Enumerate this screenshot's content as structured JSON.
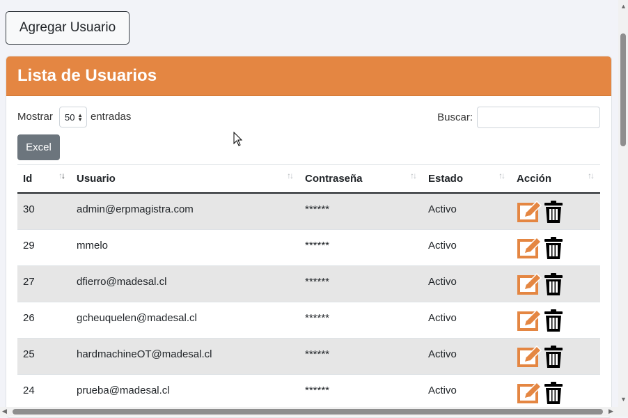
{
  "toolbar": {
    "add_label": "Agregar Usuario"
  },
  "card": {
    "title": "Lista de Usuarios"
  },
  "controls": {
    "show_label": "Mostrar",
    "page_size": "50",
    "entries_label": "entradas",
    "search_label": "Buscar:",
    "search_value": "",
    "excel_label": "Excel"
  },
  "table": {
    "columns": [
      "Id",
      "Usuario",
      "Contraseña",
      "Estado",
      "Acción"
    ],
    "rows": [
      {
        "id": "30",
        "user": "admin@erpmagistra.com",
        "password": "******",
        "status": "Activo"
      },
      {
        "id": "29",
        "user": "mmelo",
        "password": "******",
        "status": "Activo"
      },
      {
        "id": "27",
        "user": "dfierro@madesal.cl",
        "password": "******",
        "status": "Activo"
      },
      {
        "id": "26",
        "user": "gcheuquelen@madesal.cl",
        "password": "******",
        "status": "Activo"
      },
      {
        "id": "25",
        "user": "hardmachineOT@madesal.cl",
        "password": "******",
        "status": "Activo"
      },
      {
        "id": "24",
        "user": "prueba@madesal.cl",
        "password": "******",
        "status": "Activo"
      }
    ]
  },
  "icons": {
    "edit": "edit-icon",
    "delete": "trash-icon",
    "sort": "sort-icon"
  },
  "colors": {
    "header": "#e48642",
    "excel": "#6c757d",
    "edit_icon": "#e48642",
    "row_stripe": "#e6e6e6"
  }
}
